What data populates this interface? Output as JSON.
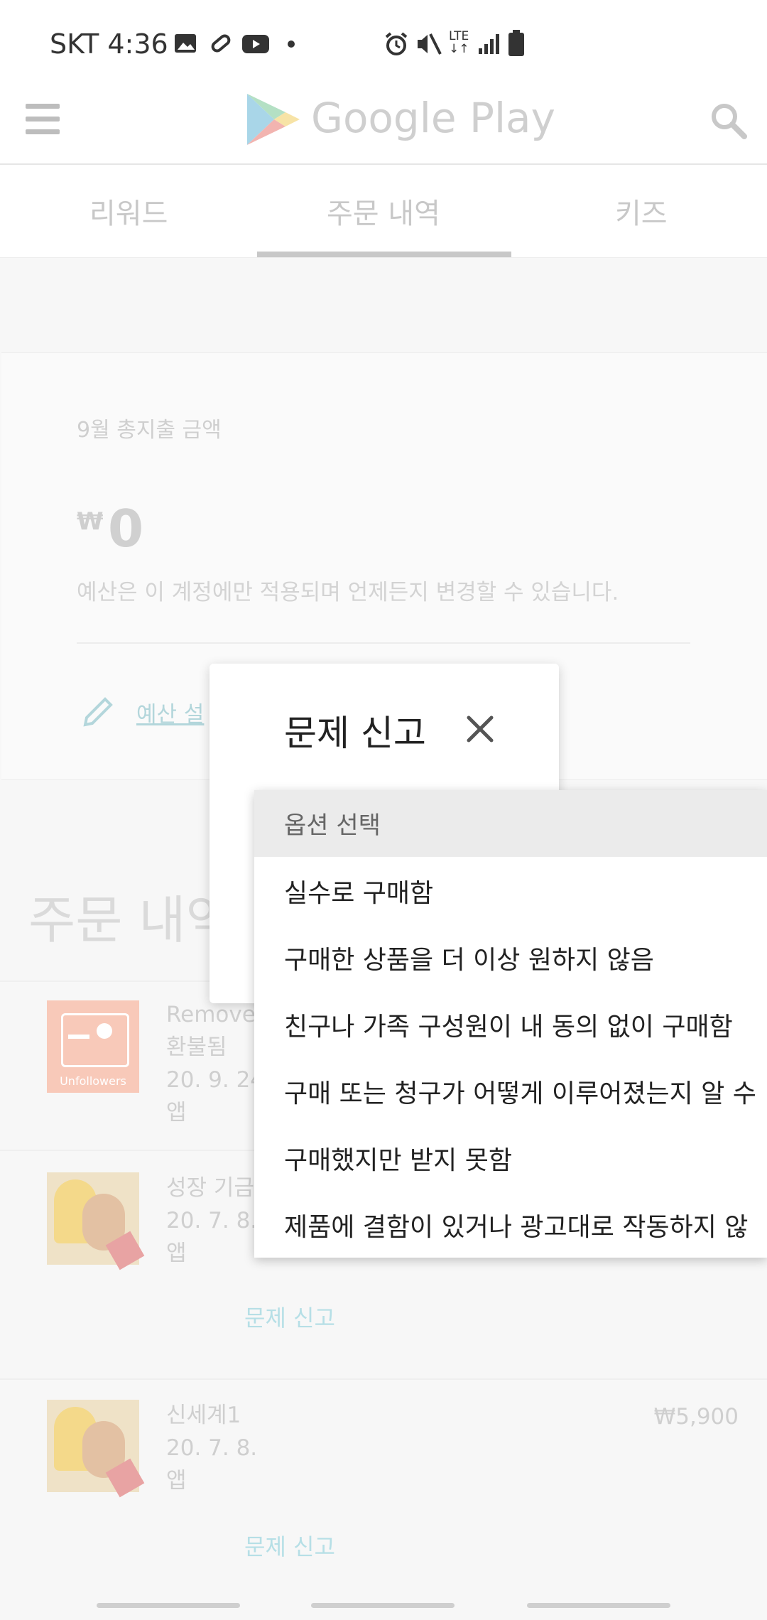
{
  "status_bar": {
    "carrier_time": "SKT 4:36",
    "network": "LTE",
    "icons": [
      "image-icon",
      "bandage-icon",
      "youtube-icon",
      "dot-icon",
      "alarm-icon",
      "mute-icon",
      "lte-icon",
      "signal-icon",
      "battery-icon"
    ]
  },
  "header": {
    "brand": "Google Play",
    "menu_icon": "menu-icon",
    "search_icon": "search-icon"
  },
  "tabs": [
    {
      "label": "리워드"
    },
    {
      "label": "주문 내역",
      "selected": true
    },
    {
      "label": "키즈"
    }
  ],
  "budget": {
    "label": "9월 총지출 금액",
    "currency": "₩",
    "amount": "0",
    "note": "예산은 이 계정에만 적용되며 언제든지 변경할 수 있습니다.",
    "link": "예산 설"
  },
  "orders": {
    "title": "주문 내역",
    "items": [
      {
        "name": "Remove",
        "status": "환불됨",
        "date": "20. 9. 24",
        "type": "앱",
        "thumb_label": "Unfollowers"
      },
      {
        "name": "성장 기금",
        "date": "20. 7. 8.",
        "type": "앱",
        "report": "문제 신고"
      },
      {
        "name": "신세계1",
        "date": "20. 7. 8.",
        "type": "앱",
        "price": "₩5,900",
        "report": "문제 신고"
      }
    ]
  },
  "dialog": {
    "title": "문제 신고",
    "close_icon": "close-icon",
    "dropdown": {
      "placeholder": "옵션 선택",
      "options": [
        "실수로 구매함",
        "구매한 상품을 더 이상 원하지 않음",
        "친구나 가족 구성원이 내 동의 없이 구매함",
        "구매 또는 청구가 어떻게 이루어졌는지 알 수",
        "구매했지만 받지 못함",
        "제품에 결함이 있거나 광고대로 작동하지 않"
      ]
    }
  },
  "colors": {
    "accent_link": "#b6dfe6",
    "scrim_text": "#cfcfcf",
    "dropdown_highlight": "#ebebeb"
  }
}
